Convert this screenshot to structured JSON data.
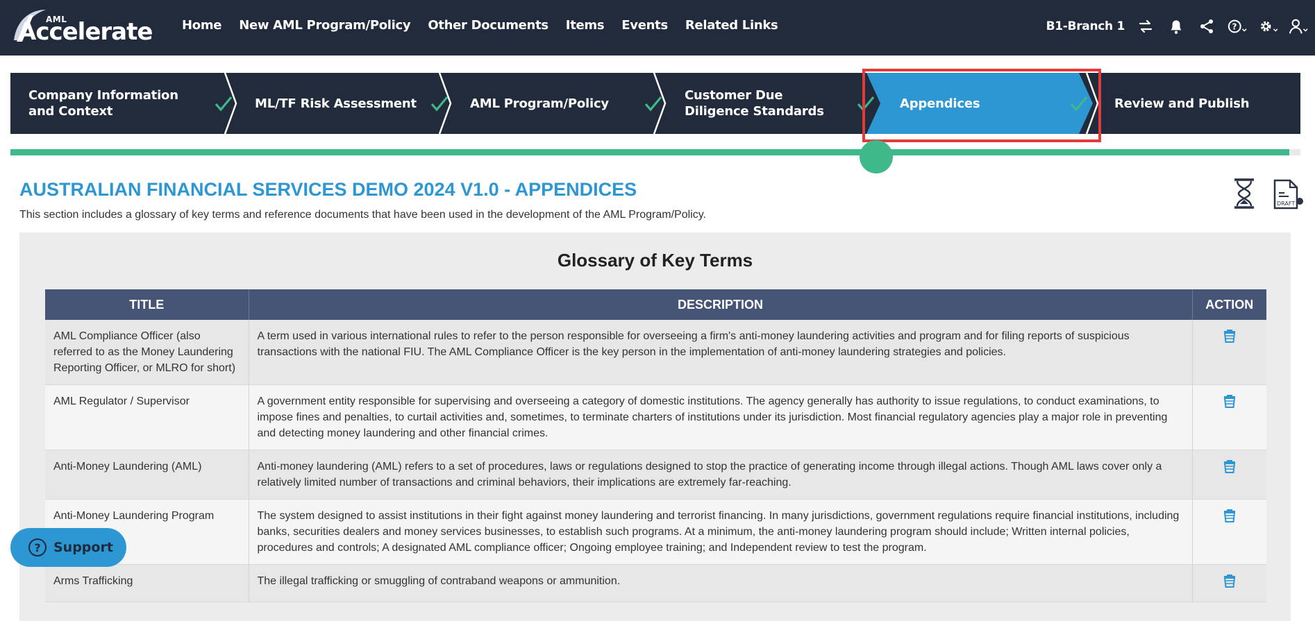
{
  "app": {
    "logo_small": "AML",
    "logo_word": "Accelerate"
  },
  "nav": {
    "items": [
      "Home",
      "New AML Program/Policy",
      "Other Documents",
      "Items",
      "Events",
      "Related Links"
    ],
    "branch": "B1-Branch 1",
    "icons": [
      "switch-icon",
      "bell-icon",
      "share-icon",
      "help-icon",
      "gear-icon",
      "user-icon"
    ]
  },
  "stepper": {
    "steps": [
      {
        "label_line1": "Company Information",
        "label_line2": "and Context",
        "done": true,
        "active": false
      },
      {
        "label_line1": "ML/TF Risk Assessment",
        "label_line2": "",
        "done": true,
        "active": false
      },
      {
        "label_line1": "AML Program/Policy",
        "label_line2": "",
        "done": true,
        "active": false
      },
      {
        "label_line1": "Customer Due",
        "label_line2": "Diligence Standards",
        "done": true,
        "active": false
      },
      {
        "label_line1": "Appendices",
        "label_line2": "",
        "done": true,
        "active": true
      },
      {
        "label_line1": "Review and Publish",
        "label_line2": "",
        "done": false,
        "active": false
      }
    ],
    "progress_percent": 67
  },
  "page": {
    "title": "AUSTRALIAN FINANCIAL SERVICES DEMO 2024 V1.0 - APPENDICES",
    "description": "This section includes a glossary of key terms and reference documents that have been used in the development of the AML Program/Policy.",
    "draft_badge": "DRAFT"
  },
  "glossary": {
    "heading": "Glossary of Key Terms",
    "columns": [
      "TITLE",
      "DESCRIPTION",
      "ACTION"
    ],
    "rows": [
      {
        "title": "AML Compliance Officer (also referred to as the Money Laundering Reporting Officer, or MLRO for short)",
        "description": "A term used in various international rules to refer to the person responsible for overseeing a firm's anti-money laundering activities and program and for filing reports of suspicious transactions with the national FIU. The AML Compliance Officer is the key person in the implementation of anti-money laundering strategies and policies."
      },
      {
        "title": "AML Regulator / Supervisor",
        "description": "A government entity responsible for supervising and overseeing a category of domestic institutions. The agency generally has authority to issue regulations, to conduct examinations, to impose fines and penalties, to curtail activities and, sometimes, to terminate charters of institutions under its jurisdiction. Most financial regulatory agencies play a major role in preventing and detecting money laundering and other financial crimes."
      },
      {
        "title": "Anti-Money Laundering (AML)",
        "description": "Anti-money laundering (AML) refers to a set of procedures, laws or regulations designed to stop the practice of generating income through illegal actions. Though AML laws cover only a relatively limited number of transactions and criminal behaviors, their implications are extremely far-reaching."
      },
      {
        "title": "Anti-Money Laundering Program",
        "description": "The system designed to assist institutions in their fight against money laundering and terrorist financing. In many jurisdictions, government regulations require financial institutions, including banks, securities dealers and money services businesses, to establish such programs. At a minimum, the anti-money laundering program should include; Written internal policies, procedures and controls; A designated AML compliance officer; Ongoing employee training; and Independent review to test the program."
      },
      {
        "title": "Arms Trafficking",
        "description": "The illegal trafficking or smuggling of contraband weapons or ammunition."
      }
    ]
  },
  "support": {
    "label": "Support"
  },
  "colors": {
    "nav_bg": "#222b3b",
    "accent": "#2d97d4",
    "progress": "#3fb98a",
    "table_header": "#465476",
    "highlight_border": "#e23b3b"
  }
}
